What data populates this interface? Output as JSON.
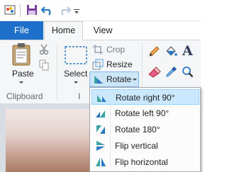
{
  "quick_access": {
    "icons": [
      "paint-app-icon",
      "save-icon",
      "undo-icon",
      "redo-icon",
      "customize-toolbar-icon"
    ]
  },
  "tabs": {
    "file": "File",
    "home": "Home",
    "view": "View"
  },
  "ribbon": {
    "clipboard": {
      "paste_label": "Paste",
      "group_label": "Clipboard"
    },
    "image": {
      "select_label": "Select",
      "crop_label": "Crop",
      "resize_label": "Resize",
      "rotate_label": "Rotate",
      "group_label_partial": "I"
    },
    "tools": {
      "text_glyph": "A"
    }
  },
  "rotate_menu": {
    "items": [
      {
        "label": "Rotate right 90°",
        "icon": "rotate-right-icon",
        "highlighted": true
      },
      {
        "label": "Rotate left 90°",
        "icon": "rotate-left-icon",
        "highlighted": false
      },
      {
        "label": "Rotate 180°",
        "icon": "rotate-180-icon",
        "highlighted": false
      },
      {
        "label": "Flip vertical",
        "icon": "flip-vertical-icon",
        "highlighted": false
      },
      {
        "label": "Flip horizontal",
        "icon": "flip-horizontal-icon",
        "highlighted": false
      }
    ]
  },
  "colors": {
    "file_tab": "#1e6fc9",
    "ribbon_bg": "#f5f6f7",
    "highlight": "#cce8ff",
    "button_active": "#cde6f7",
    "icon_blue": "#2b78c6",
    "icon_teal": "#3aa3a3"
  }
}
